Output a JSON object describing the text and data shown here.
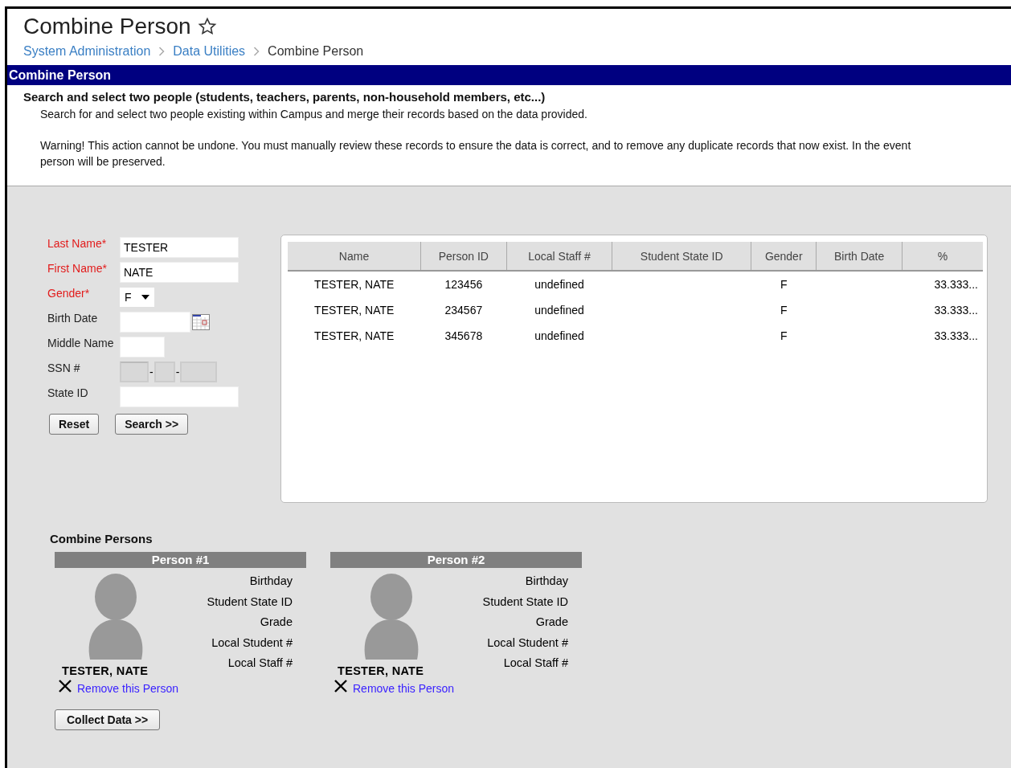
{
  "header": {
    "title": "Combine Person",
    "favorite": false,
    "breadcrumb": [
      {
        "label": "System Administration",
        "link": true
      },
      {
        "label": "Data Utilities",
        "link": true
      },
      {
        "label": "Combine Person",
        "link": false
      }
    ]
  },
  "section_bar": {
    "title": "Combine Person"
  },
  "intro": {
    "heading": "Search and select two people (students, teachers, parents, non-household members, etc...)",
    "text": "Search for and select two people existing within Campus and merge their records based on the data provided.",
    "warning_lines": [
      "Warning! This action cannot be undone. You must manually review these records to ensure the data is correct, and to remove any duplicate records that now exist. In the event",
      "person will be preserved."
    ]
  },
  "search_form": {
    "fields": [
      {
        "label": "Last Name*",
        "required": true,
        "kind": "text",
        "value": "TESTER"
      },
      {
        "label": "First Name*",
        "required": true,
        "kind": "text",
        "value": "NATE"
      },
      {
        "label": "Gender*",
        "required": true,
        "kind": "select",
        "value": "F"
      },
      {
        "label": "Birth Date",
        "required": false,
        "kind": "date"
      },
      {
        "label": "Middle Name",
        "required": false,
        "kind": "short"
      },
      {
        "label": "SSN #",
        "required": false,
        "kind": "ssn",
        "separators": [
          "-",
          "-"
        ]
      },
      {
        "label": "State ID",
        "required": false,
        "kind": "text"
      }
    ],
    "buttons": [
      "Reset",
      "Search >>"
    ]
  },
  "results": {
    "columns": [
      "Name",
      "Person ID",
      "Local Staff #",
      "Student State ID",
      "Gender",
      "Birth Date",
      "%"
    ],
    "rows": [
      [
        "TESTER, NATE",
        "123456",
        "undefined",
        "",
        "F",
        "",
        "33.333..."
      ],
      [
        "TESTER, NATE",
        "234567",
        "undefined",
        "",
        "F",
        "",
        "33.333..."
      ],
      [
        "TESTER, NATE",
        "345678",
        "undefined",
        "",
        "F",
        "",
        "33.333..."
      ]
    ]
  },
  "combine": {
    "title": "Combine Persons",
    "persons": [
      {
        "header": "Person #1",
        "name": "TESTER, NATE",
        "fields": [
          "Birthday",
          "Student State ID",
          "Grade",
          "Local Student #",
          "Local Staff #"
        ],
        "remove": "Remove this Person"
      },
      {
        "header": "Person #2",
        "name": "TESTER, NATE",
        "fields": [
          "Birthday",
          "Student State ID",
          "Grade",
          "Local Student #",
          "Local Staff #"
        ],
        "remove": "Remove this Person"
      }
    ],
    "button": "Collect Data >>"
  }
}
